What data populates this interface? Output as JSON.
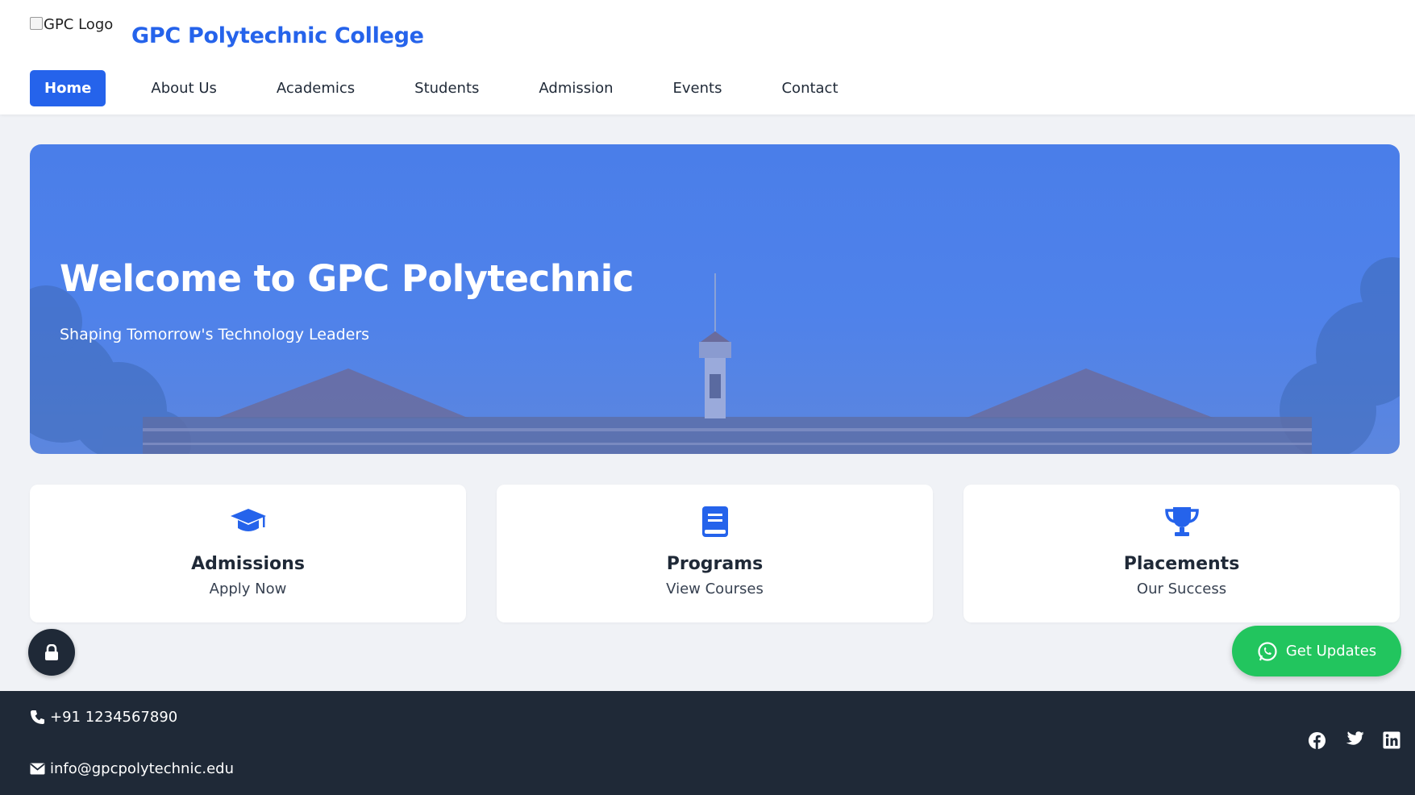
{
  "header": {
    "logo_alt": "GPC Logo",
    "site_title": "GPC Polytechnic College",
    "nav": [
      {
        "label": "Home",
        "active": true
      },
      {
        "label": "About Us"
      },
      {
        "label": "Academics"
      },
      {
        "label": "Students"
      },
      {
        "label": "Admission"
      },
      {
        "label": "Events"
      },
      {
        "label": "Contact"
      }
    ]
  },
  "hero": {
    "title": "Welcome to GPC Polytechnic",
    "subtitle": "Shaping Tomorrow's Technology Leaders"
  },
  "cards": [
    {
      "icon": "graduation-cap-icon",
      "title": "Admissions",
      "subtitle": "Apply Now"
    },
    {
      "icon": "book-icon",
      "title": "Programs",
      "subtitle": "View Courses"
    },
    {
      "icon": "trophy-icon",
      "title": "Placements",
      "subtitle": "Our Success"
    }
  ],
  "floating": {
    "lock_icon": "lock-icon",
    "updates_label": "Get Updates",
    "updates_icon": "whatsapp-icon"
  },
  "footer": {
    "phone": "+91 1234567890",
    "email": "info@gpcpolytechnic.edu",
    "social": [
      "facebook-icon",
      "twitter-icon",
      "linkedin-icon"
    ]
  },
  "colors": {
    "primary": "#2563eb",
    "footer_bg": "#1f2937",
    "whatsapp_green": "#22c55e",
    "page_bg": "#f0f2f6"
  }
}
